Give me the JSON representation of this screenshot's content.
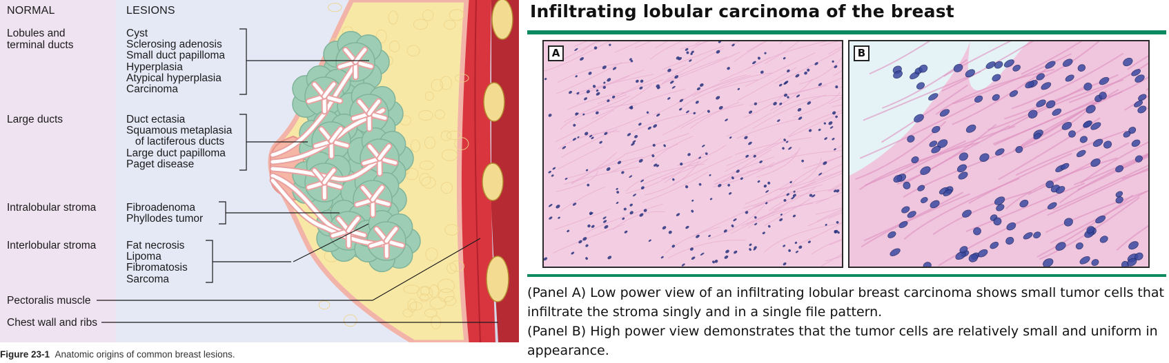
{
  "diagram": {
    "header_normal": "NORMAL",
    "header_lesions": "LESIONS",
    "normal_labels": [
      "Lobules and\nterminal ducts",
      "Large ducts",
      "Intralobular stroma",
      "Interlobular stroma",
      "Pectoralis muscle",
      "Chest wall and ribs"
    ],
    "lesion_groups": [
      [
        "Cyst",
        "Sclerosing adenosis",
        "Small duct papilloma",
        "Hyperplasia",
        "Atypical hyperplasia",
        "Carcinoma"
      ],
      [
        "Duct ectasia",
        "Squamous metaplasia",
        "   of lactiferous ducts",
        "Large duct papilloma",
        "Paget disease"
      ],
      [
        "Fibroadenoma",
        "Phyllodes tumor"
      ],
      [
        "Fat necrosis",
        "Lipoma",
        "Fibromatosis",
        "Sarcoma"
      ]
    ],
    "caption_bold": "Figure 23-1",
    "caption_text": "Anatomic origins of common breast lesions."
  },
  "histology": {
    "title": "Infiltrating lobular carcinoma of the breast",
    "panel_a_tag": "A",
    "panel_b_tag": "B",
    "desc_a": "(Panel A) Low power view of an infiltrating lobular breast carcinoma shows small tumor cells that infiltrate the stroma singly and in a single file pattern.",
    "desc_b": "(Panel B) High power view demonstrates that the tumor cells are relatively small and uniform in appearance."
  },
  "colors": {
    "accent_rule": "#0e8a63",
    "normal_column": "#efe2f1",
    "lesions_column": "#e5e9f6",
    "fat": "#f8e8a6",
    "lobule": "#9ecdb5",
    "muscle": "#d9353f",
    "stroma_pink": "#f2c7dd",
    "nuclei": "#27337e"
  }
}
